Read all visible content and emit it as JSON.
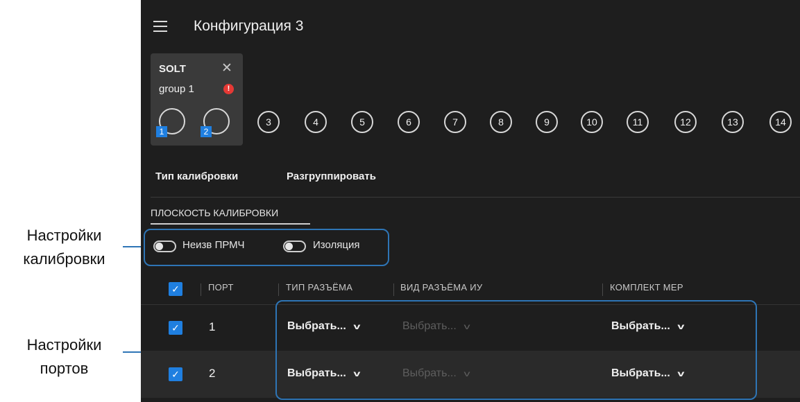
{
  "annotations": {
    "calibration_settings": [
      "Настройки",
      "калибровки"
    ],
    "port_settings": [
      "Настройки",
      "портов"
    ]
  },
  "app": {
    "title": "Конфигурация 3",
    "group": {
      "type": "SOLT",
      "name": "group 1",
      "ports": [
        "1",
        "2"
      ]
    },
    "ports": [
      "3",
      "4",
      "5",
      "6",
      "7",
      "8",
      "9",
      "10",
      "11",
      "12",
      "13",
      "14"
    ],
    "actions": {
      "cal_type": "Тип калибровки",
      "ungroup": "Разгруппировать"
    },
    "tab": "ПЛОСКОСТЬ КАЛИБРОВКИ",
    "toggles": [
      {
        "label": "Неизв ПРМЧ",
        "on": false
      },
      {
        "label": "Изоляция",
        "on": false
      }
    ],
    "table": {
      "headers": [
        "ПОРТ",
        "ТИП РАЗЪЁМА",
        "ВИД РАЗЪЁМА ИУ",
        "КОМПЛЕКТ МЕР"
      ],
      "rows": [
        {
          "port": "1",
          "connector_type": "Выбрать...",
          "dut_connector": "Выбрать...",
          "cal_kit": "Выбрать..."
        },
        {
          "port": "2",
          "connector_type": "Выбрать...",
          "dut_connector": "Выбрать...",
          "cal_kit": "Выбрать..."
        }
      ]
    }
  },
  "colors": {
    "accent": "#1f7fe0",
    "annotation": "#2e75b6",
    "background": "#1e1e1e",
    "error": "#e53935"
  }
}
